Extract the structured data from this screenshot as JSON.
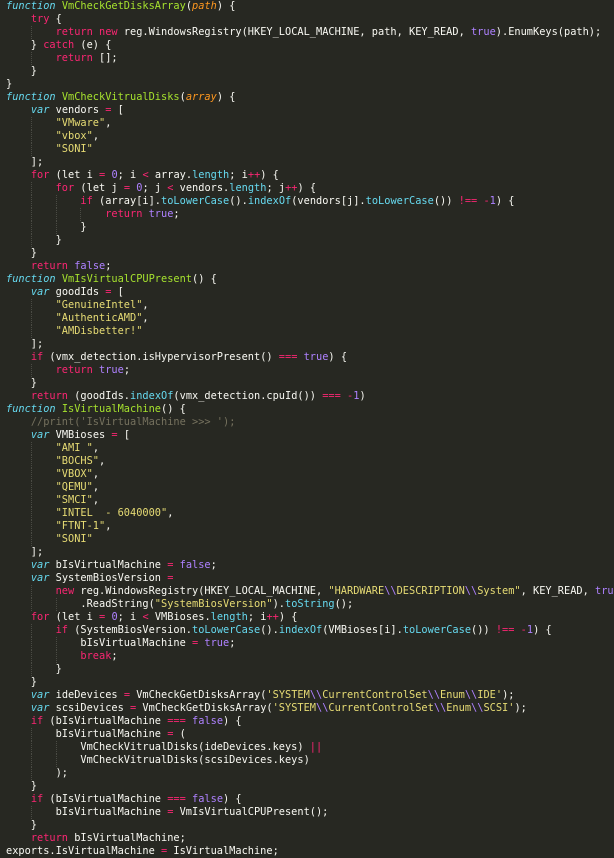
{
  "editor": {
    "language": "javascript",
    "theme_colors": {
      "background": "#272822",
      "keyword": "#f92672",
      "storage": "#66d9ef",
      "function_name": "#a6e22e",
      "parameter": "#fd971f",
      "string": "#e6db74",
      "constant": "#ae81ff",
      "comment": "#75715e",
      "text": "#f8f8f2"
    },
    "lines": [
      [
        [
          "kw",
          "function"
        ],
        [
          "p",
          " "
        ],
        [
          "fn",
          "VmCheckGetDisksArray"
        ],
        [
          "p",
          "("
        ],
        [
          "param",
          "path"
        ],
        [
          "p",
          ") {"
        ]
      ],
      [
        [
          "p",
          "    "
        ],
        [
          "key",
          "try"
        ],
        [
          "p",
          " {"
        ]
      ],
      [
        [
          "p",
          "        "
        ],
        [
          "key",
          "return"
        ],
        [
          "p",
          " "
        ],
        [
          "key",
          "new"
        ],
        [
          "p",
          " reg.WindowsRegistry(HKEY_LOCAL_MACHINE, path, KEY_READ, "
        ],
        [
          "bool",
          "true"
        ],
        [
          "p",
          ").EnumKeys(path);"
        ]
      ],
      [
        [
          "p",
          "    } "
        ],
        [
          "key",
          "catch"
        ],
        [
          "p",
          " (e) {"
        ]
      ],
      [
        [
          "p",
          "        "
        ],
        [
          "key",
          "return"
        ],
        [
          "p",
          " [];"
        ]
      ],
      [
        [
          "p",
          "    }"
        ]
      ],
      [
        [
          "p",
          "}"
        ]
      ],
      [
        [
          "kw",
          "function"
        ],
        [
          "p",
          " "
        ],
        [
          "fn",
          "VmCheckVitrualDisks"
        ],
        [
          "p",
          "("
        ],
        [
          "param",
          "array"
        ],
        [
          "p",
          ") {"
        ]
      ],
      [
        [
          "p",
          "    "
        ],
        [
          "kw",
          "var"
        ],
        [
          "p",
          " vendors "
        ],
        [
          "op",
          "="
        ],
        [
          "p",
          " ["
        ]
      ],
      [
        [
          "p",
          "        "
        ],
        [
          "str",
          "\"VMware\""
        ],
        [
          "p",
          ","
        ]
      ],
      [
        [
          "p",
          "        "
        ],
        [
          "str",
          "\"vbox\""
        ],
        [
          "p",
          ","
        ]
      ],
      [
        [
          "p",
          "        "
        ],
        [
          "str",
          "\"SONI\""
        ]
      ],
      [
        [
          "p",
          "    ];"
        ]
      ],
      [
        [
          "p",
          "    "
        ],
        [
          "key",
          "for"
        ],
        [
          "p",
          " (let i "
        ],
        [
          "op",
          "="
        ],
        [
          "p",
          " "
        ],
        [
          "num",
          "0"
        ],
        [
          "p",
          "; i "
        ],
        [
          "op",
          "<"
        ],
        [
          "p",
          " array."
        ],
        [
          "prop",
          "length"
        ],
        [
          "p",
          "; i"
        ],
        [
          "op",
          "++"
        ],
        [
          "p",
          ") {"
        ]
      ],
      [
        [
          "p",
          "        "
        ],
        [
          "key",
          "for"
        ],
        [
          "p",
          " (let j "
        ],
        [
          "op",
          "="
        ],
        [
          "p",
          " "
        ],
        [
          "num",
          "0"
        ],
        [
          "p",
          "; j "
        ],
        [
          "op",
          "<"
        ],
        [
          "p",
          " vendors."
        ],
        [
          "prop",
          "length"
        ],
        [
          "p",
          "; j"
        ],
        [
          "op",
          "++"
        ],
        [
          "p",
          ") {"
        ]
      ],
      [
        [
          "p",
          "            "
        ],
        [
          "key",
          "if"
        ],
        [
          "p",
          " (array[i]."
        ],
        [
          "prop",
          "toLowerCase"
        ],
        [
          "p",
          "()."
        ],
        [
          "prop",
          "indexOf"
        ],
        [
          "p",
          "(vendors[j]."
        ],
        [
          "prop",
          "toLowerCase"
        ],
        [
          "p",
          "()) "
        ],
        [
          "op",
          "!=="
        ],
        [
          "p",
          " "
        ],
        [
          "op",
          "-"
        ],
        [
          "num",
          "1"
        ],
        [
          "p",
          ") {"
        ]
      ],
      [
        [
          "p",
          "                "
        ],
        [
          "key",
          "return"
        ],
        [
          "p",
          " "
        ],
        [
          "bool",
          "true"
        ],
        [
          "p",
          ";"
        ]
      ],
      [
        [
          "p",
          "            }"
        ]
      ],
      [
        [
          "p",
          "        }"
        ]
      ],
      [
        [
          "p",
          "    }"
        ]
      ],
      [
        [
          "p",
          "    "
        ],
        [
          "key",
          "return"
        ],
        [
          "p",
          " "
        ],
        [
          "bool",
          "false"
        ],
        [
          "p",
          ";"
        ]
      ],
      [
        [
          "kw",
          "function"
        ],
        [
          "p",
          " "
        ],
        [
          "fn",
          "VmIsVirtualCPUPresent"
        ],
        [
          "p",
          "() {"
        ]
      ],
      [
        [
          "p",
          "    "
        ],
        [
          "kw",
          "var"
        ],
        [
          "p",
          " goodIds "
        ],
        [
          "op",
          "="
        ],
        [
          "p",
          " ["
        ]
      ],
      [
        [
          "p",
          "        "
        ],
        [
          "str",
          "\"GenuineIntel\""
        ],
        [
          "p",
          ","
        ]
      ],
      [
        [
          "p",
          "        "
        ],
        [
          "str",
          "\"AuthenticAMD\""
        ],
        [
          "p",
          ","
        ]
      ],
      [
        [
          "p",
          "        "
        ],
        [
          "str",
          "\"AMDisbetter!\""
        ]
      ],
      [
        [
          "p",
          "    ];"
        ]
      ],
      [
        [
          "p",
          "    "
        ],
        [
          "key",
          "if"
        ],
        [
          "p",
          " (vmx_detection.isHypervisorPresent() "
        ],
        [
          "op",
          "==="
        ],
        [
          "p",
          " "
        ],
        [
          "bool",
          "true"
        ],
        [
          "p",
          ") {"
        ]
      ],
      [
        [
          "p",
          "        "
        ],
        [
          "key",
          "return"
        ],
        [
          "p",
          " "
        ],
        [
          "bool",
          "true"
        ],
        [
          "p",
          ";"
        ]
      ],
      [
        [
          "p",
          "    }"
        ]
      ],
      [
        [
          "p",
          "    "
        ],
        [
          "key",
          "return"
        ],
        [
          "p",
          " (goodIds."
        ],
        [
          "prop",
          "indexOf"
        ],
        [
          "p",
          "(vmx_detection.cpuId()) "
        ],
        [
          "op",
          "==="
        ],
        [
          "p",
          " "
        ],
        [
          "op",
          "-"
        ],
        [
          "num",
          "1"
        ],
        [
          "p",
          ")"
        ]
      ],
      [
        [
          "kw",
          "function"
        ],
        [
          "p",
          " "
        ],
        [
          "fn",
          "IsVirtualMachine"
        ],
        [
          "p",
          "() {"
        ]
      ],
      [
        [
          "p",
          "    "
        ],
        [
          "cm",
          "//print('IsVirtualMachine >>> ');"
        ]
      ],
      [
        [
          "p",
          "    "
        ],
        [
          "kw",
          "var"
        ],
        [
          "p",
          " VMBioses "
        ],
        [
          "op",
          "="
        ],
        [
          "p",
          " ["
        ]
      ],
      [
        [
          "p",
          "        "
        ],
        [
          "str",
          "\"AMI \""
        ],
        [
          "p",
          ","
        ]
      ],
      [
        [
          "p",
          "        "
        ],
        [
          "str",
          "\"BOCHS\""
        ],
        [
          "p",
          ","
        ]
      ],
      [
        [
          "p",
          "        "
        ],
        [
          "str",
          "\"VBOX\""
        ],
        [
          "p",
          ","
        ]
      ],
      [
        [
          "p",
          "        "
        ],
        [
          "str",
          "\"QEMU\""
        ],
        [
          "p",
          ","
        ]
      ],
      [
        [
          "p",
          "        "
        ],
        [
          "str",
          "\"SMCI\""
        ],
        [
          "p",
          ","
        ]
      ],
      [
        [
          "p",
          "        "
        ],
        [
          "str",
          "\"INTEL  - 6040000\""
        ],
        [
          "p",
          ","
        ]
      ],
      [
        [
          "p",
          "        "
        ],
        [
          "str",
          "\"FTNT-1\""
        ],
        [
          "p",
          ","
        ]
      ],
      [
        [
          "p",
          "        "
        ],
        [
          "str",
          "\"SONI\""
        ]
      ],
      [
        [
          "p",
          "    ];"
        ]
      ],
      [
        [
          "p",
          "    "
        ],
        [
          "kw",
          "var"
        ],
        [
          "p",
          " bIsVirtualMachine "
        ],
        [
          "op",
          "="
        ],
        [
          "p",
          " "
        ],
        [
          "bool",
          "false"
        ],
        [
          "p",
          ";"
        ]
      ],
      [
        [
          "p",
          "    "
        ],
        [
          "kw",
          "var"
        ],
        [
          "p",
          " SystemBiosVersion "
        ],
        [
          "op",
          "="
        ]
      ],
      [
        [
          "p",
          "        "
        ],
        [
          "key",
          "new"
        ],
        [
          "p",
          " reg.WindowsRegistry(HKEY_LOCAL_MACHINE, "
        ],
        [
          "str",
          "\"HARDWARE"
        ],
        [
          "esc",
          "\\\\"
        ],
        [
          "str",
          "DESCRIPTION"
        ],
        [
          "esc",
          "\\\\"
        ],
        [
          "str",
          "System\""
        ],
        [
          "p",
          ", KEY_READ, "
        ],
        [
          "bool",
          "true"
        ],
        [
          "p",
          ")"
        ]
      ],
      [
        [
          "p",
          "            .ReadString("
        ],
        [
          "str",
          "\"SystemBiosVersion\""
        ],
        [
          "p",
          ")."
        ],
        [
          "prop",
          "toString"
        ],
        [
          "p",
          "();"
        ]
      ],
      [
        [
          "p",
          "    "
        ],
        [
          "key",
          "for"
        ],
        [
          "p",
          " (let i "
        ],
        [
          "op",
          "="
        ],
        [
          "p",
          " "
        ],
        [
          "num",
          "0"
        ],
        [
          "p",
          "; i "
        ],
        [
          "op",
          "<"
        ],
        [
          "p",
          " VMBioses."
        ],
        [
          "prop",
          "length"
        ],
        [
          "p",
          "; i"
        ],
        [
          "op",
          "++"
        ],
        [
          "p",
          ") {"
        ]
      ],
      [
        [
          "p",
          "        "
        ],
        [
          "key",
          "if"
        ],
        [
          "p",
          " (SystemBiosVersion."
        ],
        [
          "prop",
          "toLowerCase"
        ],
        [
          "p",
          "()."
        ],
        [
          "prop",
          "indexOf"
        ],
        [
          "p",
          "(VMBioses[i]."
        ],
        [
          "prop",
          "toLowerCase"
        ],
        [
          "p",
          "()) "
        ],
        [
          "op",
          "!=="
        ],
        [
          "p",
          " "
        ],
        [
          "op",
          "-"
        ],
        [
          "num",
          "1"
        ],
        [
          "p",
          ") {"
        ]
      ],
      [
        [
          "p",
          "            bIsVirtualMachine "
        ],
        [
          "op",
          "="
        ],
        [
          "p",
          " "
        ],
        [
          "bool",
          "true"
        ],
        [
          "p",
          ";"
        ]
      ],
      [
        [
          "p",
          "            "
        ],
        [
          "key",
          "break"
        ],
        [
          "p",
          ";"
        ]
      ],
      [
        [
          "p",
          "        }"
        ]
      ],
      [
        [
          "p",
          "    }"
        ]
      ],
      [
        [
          "p",
          "    "
        ],
        [
          "kw",
          "var"
        ],
        [
          "p",
          " ideDevices "
        ],
        [
          "op",
          "="
        ],
        [
          "p",
          " VmCheckGetDisksArray("
        ],
        [
          "str",
          "'SYSTEM"
        ],
        [
          "esc",
          "\\\\"
        ],
        [
          "str",
          "CurrentControlSet"
        ],
        [
          "esc",
          "\\\\"
        ],
        [
          "str",
          "Enum"
        ],
        [
          "esc",
          "\\\\"
        ],
        [
          "str",
          "IDE'"
        ],
        [
          "p",
          ");"
        ]
      ],
      [
        [
          "p",
          "    "
        ],
        [
          "kw",
          "var"
        ],
        [
          "p",
          " scsiDevices "
        ],
        [
          "op",
          "="
        ],
        [
          "p",
          " VmCheckGetDisksArray("
        ],
        [
          "str",
          "'SYSTEM"
        ],
        [
          "esc",
          "\\\\"
        ],
        [
          "str",
          "CurrentControlSet"
        ],
        [
          "esc",
          "\\\\"
        ],
        [
          "str",
          "Enum"
        ],
        [
          "esc",
          "\\\\"
        ],
        [
          "str",
          "SCSI'"
        ],
        [
          "p",
          ");"
        ]
      ],
      [
        [
          "p",
          "    "
        ],
        [
          "key",
          "if"
        ],
        [
          "p",
          " (bIsVirtualMachine "
        ],
        [
          "op",
          "==="
        ],
        [
          "p",
          " "
        ],
        [
          "bool",
          "false"
        ],
        [
          "p",
          ") {"
        ]
      ],
      [
        [
          "p",
          "        bIsVirtualMachine "
        ],
        [
          "op",
          "="
        ],
        [
          "p",
          " ("
        ]
      ],
      [
        [
          "p",
          "            VmCheckVitrualDisks(ideDevices.keys) "
        ],
        [
          "op",
          "||"
        ]
      ],
      [
        [
          "p",
          "            VmCheckVitrualDisks(scsiDevices.keys)"
        ]
      ],
      [
        [
          "p",
          "        );"
        ]
      ],
      [
        [
          "p",
          "    }"
        ]
      ],
      [
        [
          "p",
          "    "
        ],
        [
          "key",
          "if"
        ],
        [
          "p",
          " (bIsVirtualMachine "
        ],
        [
          "op",
          "==="
        ],
        [
          "p",
          " "
        ],
        [
          "bool",
          "false"
        ],
        [
          "p",
          ") {"
        ]
      ],
      [
        [
          "p",
          "        bIsVirtualMachine "
        ],
        [
          "op",
          "="
        ],
        [
          "p",
          " VmIsVirtualCPUPresent();"
        ]
      ],
      [
        [
          "p",
          "    }"
        ]
      ],
      [
        [
          "p",
          "    "
        ],
        [
          "key",
          "return"
        ],
        [
          "p",
          " bIsVirtualMachine;"
        ]
      ],
      [
        [
          "p",
          "exports.IsVirtualMachine "
        ],
        [
          "op",
          "="
        ],
        [
          "p",
          " IsVirtualMachine;"
        ]
      ]
    ]
  }
}
